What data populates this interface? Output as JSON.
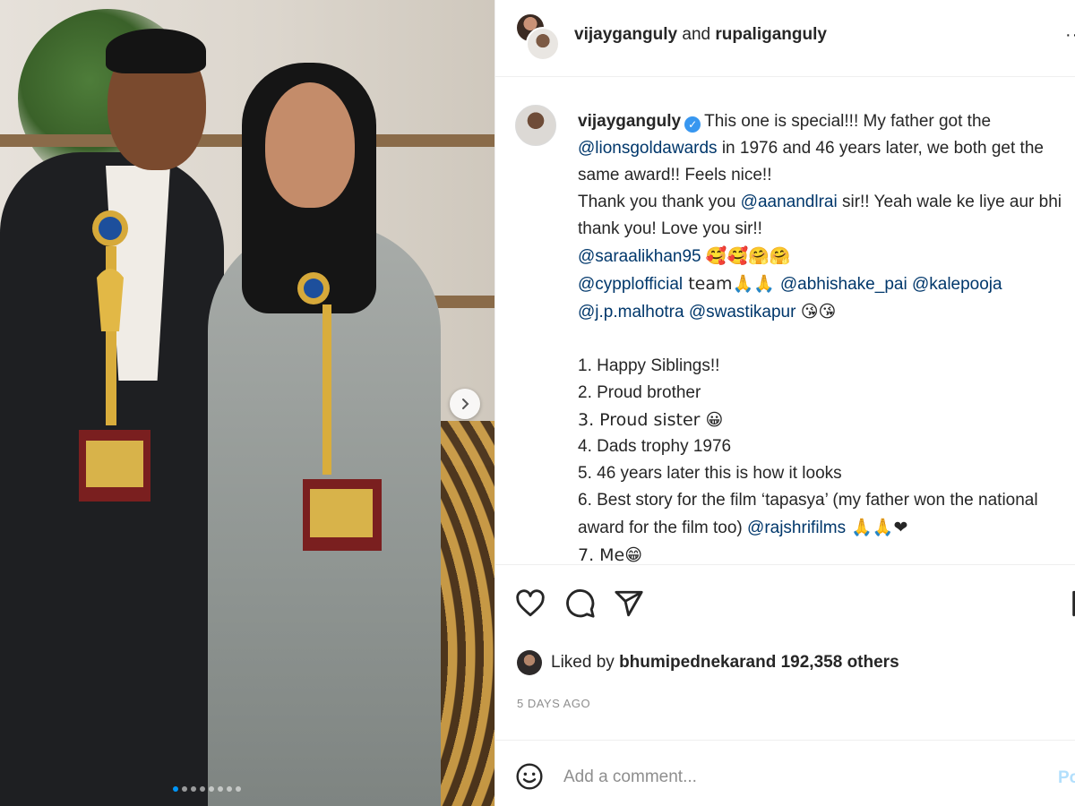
{
  "post": {
    "header": {
      "user1": "vijayganguly",
      "joiner": "and",
      "user2": "rupaliganguly",
      "more_icon": "more-dots-icon"
    },
    "caption": {
      "author": "vijayganguly",
      "lines": [
        {
          "pre": "",
          "text1": "This one is special!!! My father got the",
          "mention": "",
          "text2": ""
        },
        {
          "pre": "",
          "text1": "",
          "mention": "@lionsgoldawards",
          "text2": " in 1976 and 46 years later, we both get the"
        },
        {
          "pre": "",
          "text1": "same award!! Feels nice!!",
          "mention": "",
          "text2": ""
        },
        {
          "pre": "",
          "text1": "Thank you thank you ",
          "mention": "@aanandlrai",
          "text2": " sir!! Yeah wale ke liye aur bhi"
        },
        {
          "pre": "",
          "text1": "thank you! Love you sir!!",
          "mention": "",
          "text2": ""
        }
      ],
      "mention_lines": {
        "l6_mention": "@saraalikhan95",
        "l6_emoji": "🥰🥰🤗🤗",
        "l7_mention1": "@cypplofficial",
        "l7_text": " team🙏🙏 ",
        "l7_mention2": "@abhishake_pai",
        "l7_mention3": "@kalepooja",
        "l8_mention1": "@j.p.malhotra",
        "l8_mention2": "@swastikapur",
        "l8_emoji": "😘😘"
      },
      "list": [
        "1. Happy Siblings!!",
        "2. Proud brother",
        "3. Proud sister 😀",
        "4. Dads trophy 1976",
        "5. 46 years later this is how it looks",
        "6. Best story for the film ‘tapasya’ (my father won the national"
      ],
      "list6b_text": "award for the film too) ",
      "list6b_mention": "@rajshrifilms",
      "list6b_emoji": " 🙏🙏❤",
      "list7": "7. Me😁"
    },
    "likes": {
      "prefix": "Liked by ",
      "user": "bhumipednekar",
      "suffix": " and 192,358 others"
    },
    "time": "5 DAYS AGO",
    "comment": {
      "placeholder": "Add a comment...",
      "post_label": "Po"
    },
    "carousel": {
      "total": 8,
      "active_index": 0
    },
    "icons": {
      "like": "heart-icon",
      "comment": "comment-icon",
      "share": "share-icon",
      "save": "bookmark-icon",
      "emoji": "smile-icon",
      "next": "chevron-right-icon"
    },
    "colors": {
      "mention": "#00376b",
      "verified": "#3897f0",
      "post_disabled": "#b2dffc",
      "dot_active": "#0095f6"
    }
  }
}
